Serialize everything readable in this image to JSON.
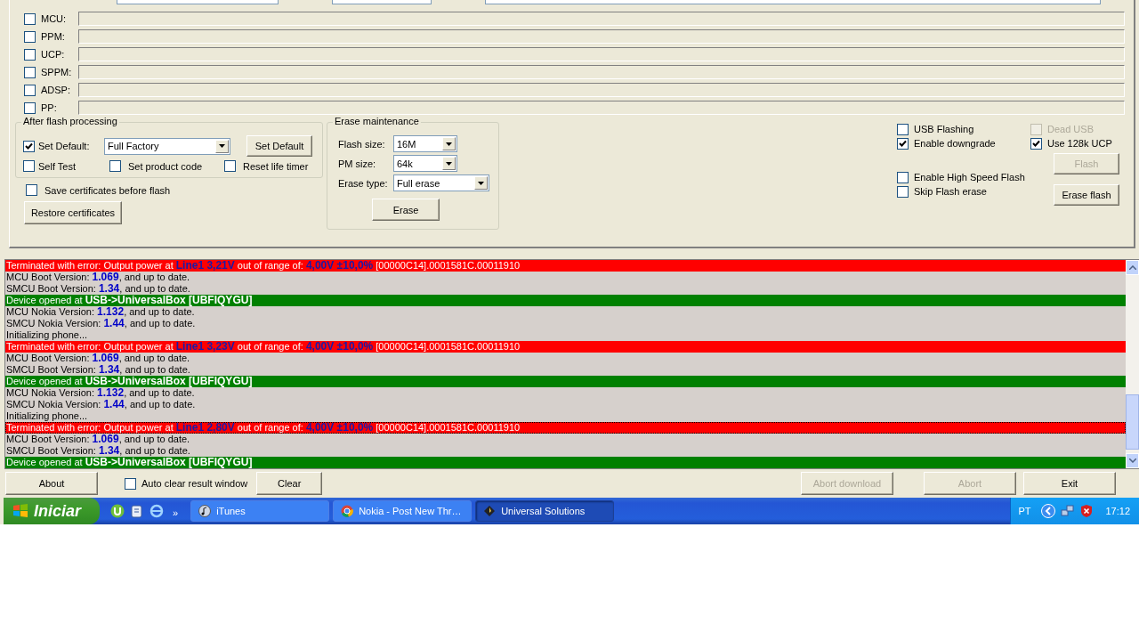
{
  "partitions": [
    {
      "label": "MCU:",
      "checked": false
    },
    {
      "label": "PPM:",
      "checked": false
    },
    {
      "label": "UCP:",
      "checked": false
    },
    {
      "label": "SPPM:",
      "checked": false
    },
    {
      "label": "ADSP:",
      "checked": false
    },
    {
      "label": "PP:",
      "checked": false
    }
  ],
  "after_flash": {
    "title": "After flash processing",
    "set_default": {
      "label": "Set Default:",
      "checked": true
    },
    "mode": {
      "value": "Full Factory"
    },
    "set_default_button": "Set Default",
    "self_test": {
      "label": "Self Test",
      "checked": false
    },
    "set_product_code": {
      "label": "Set product code",
      "checked": false
    },
    "reset_life_timer": {
      "label": "Reset life timer",
      "checked": false
    }
  },
  "save_certificates": {
    "label": "Save certificates before flash",
    "checked": false
  },
  "restore_certificates_button": "Restore certificates",
  "erase_maintenance": {
    "title": "Erase maintenance",
    "fields": [
      {
        "label": "Flash size:",
        "value": "16M"
      },
      {
        "label": "PM size:",
        "value": "64k"
      },
      {
        "label": "Erase type:",
        "value": "Full erase"
      }
    ],
    "erase_button": "Erase"
  },
  "options": [
    {
      "label": "USB Flashing",
      "checked": false,
      "disabled": false
    },
    {
      "label": "Enable downgrade",
      "checked": true,
      "disabled": false
    },
    {
      "label": "Enable High Speed Flash",
      "checked": false,
      "disabled": false
    },
    {
      "label": "Skip Flash erase",
      "checked": false,
      "disabled": false
    }
  ],
  "side_options": [
    {
      "label": "Dead USB",
      "checked": false,
      "disabled": true
    },
    {
      "label": "Use 128k UCP",
      "checked": true,
      "disabled": false
    }
  ],
  "flash_button": {
    "label": "Flash",
    "disabled": true
  },
  "erase_flash_button": {
    "label": "Erase flash",
    "disabled": false
  },
  "log": [
    {
      "kind": "error",
      "selected": false,
      "text": "Terminated with error: Output power at **Line1 3,21V** out of range of: **4,00V ±10,0%** [00000C14].0001581C.00011910"
    },
    {
      "kind": "info",
      "selected": false,
      "text": "MCU Boot Version: **1.069**, and up to date."
    },
    {
      "kind": "info",
      "selected": false,
      "text": "SMCU Boot Version: **1.34**, and up to date."
    },
    {
      "kind": "device",
      "selected": false,
      "text": "Device opened at **USB->UniversalBox [UBFIQYGU]**"
    },
    {
      "kind": "info",
      "selected": false,
      "text": "MCU Nokia Version: **1.132**, and up to date."
    },
    {
      "kind": "info",
      "selected": false,
      "text": "SMCU Nokia Version: **1.44**, and up to date."
    },
    {
      "kind": "info",
      "selected": false,
      "text": "Initializing phone..."
    },
    {
      "kind": "error",
      "selected": false,
      "text": "Terminated with error: Output power at **Line1 3,23V** out of range of: **4,00V ±10,0%** [00000C14].0001581C.00011910"
    },
    {
      "kind": "info",
      "selected": false,
      "text": "MCU Boot Version: **1.069**, and up to date."
    },
    {
      "kind": "info",
      "selected": false,
      "text": "SMCU Boot Version: **1.34**, and up to date."
    },
    {
      "kind": "device",
      "selected": false,
      "text": "Device opened at **USB->UniversalBox [UBFIQYGU]**"
    },
    {
      "kind": "info",
      "selected": false,
      "text": "MCU Nokia Version: **1.132**, and up to date."
    },
    {
      "kind": "info",
      "selected": false,
      "text": "SMCU Nokia Version: **1.44**, and up to date."
    },
    {
      "kind": "info",
      "selected": false,
      "text": "Initializing phone..."
    },
    {
      "kind": "error",
      "selected": true,
      "text": "Terminated with error: Output power at **Line1 2,80V** out of range of: **4,00V ±10,0%** [00000C14].0001581C.00011910"
    },
    {
      "kind": "info",
      "selected": false,
      "text": "MCU Boot Version: **1.069**, and up to date."
    },
    {
      "kind": "info",
      "selected": false,
      "text": "SMCU Boot Version: **1.34**, and up to date."
    },
    {
      "kind": "device",
      "selected": false,
      "text": "Device opened at **USB->UniversalBox [UBFIQYGU]**"
    }
  ],
  "bottom_bar": {
    "about_button": {
      "label": "About",
      "disabled": false
    },
    "auto_clear": {
      "label": "Auto clear result window",
      "checked": false
    },
    "clear_button": {
      "label": "Clear",
      "disabled": false
    },
    "abort_download_button": {
      "label": "Abort download",
      "disabled": true
    },
    "abort_button": {
      "label": "Abort",
      "disabled": true
    },
    "exit_button": {
      "label": "Exit",
      "disabled": false
    }
  },
  "taskbar": {
    "start_button": "Iniciar",
    "quick_launch_more": "»",
    "tasks": [
      {
        "label": "iTunes",
        "selected": false,
        "kind": "music"
      },
      {
        "label": "Nokia - Post New Thr…",
        "selected": false,
        "kind": "browser"
      },
      {
        "label": "Universal Solutions",
        "selected": true,
        "kind": "app"
      }
    ],
    "language": "PT",
    "clock": "17:12"
  }
}
